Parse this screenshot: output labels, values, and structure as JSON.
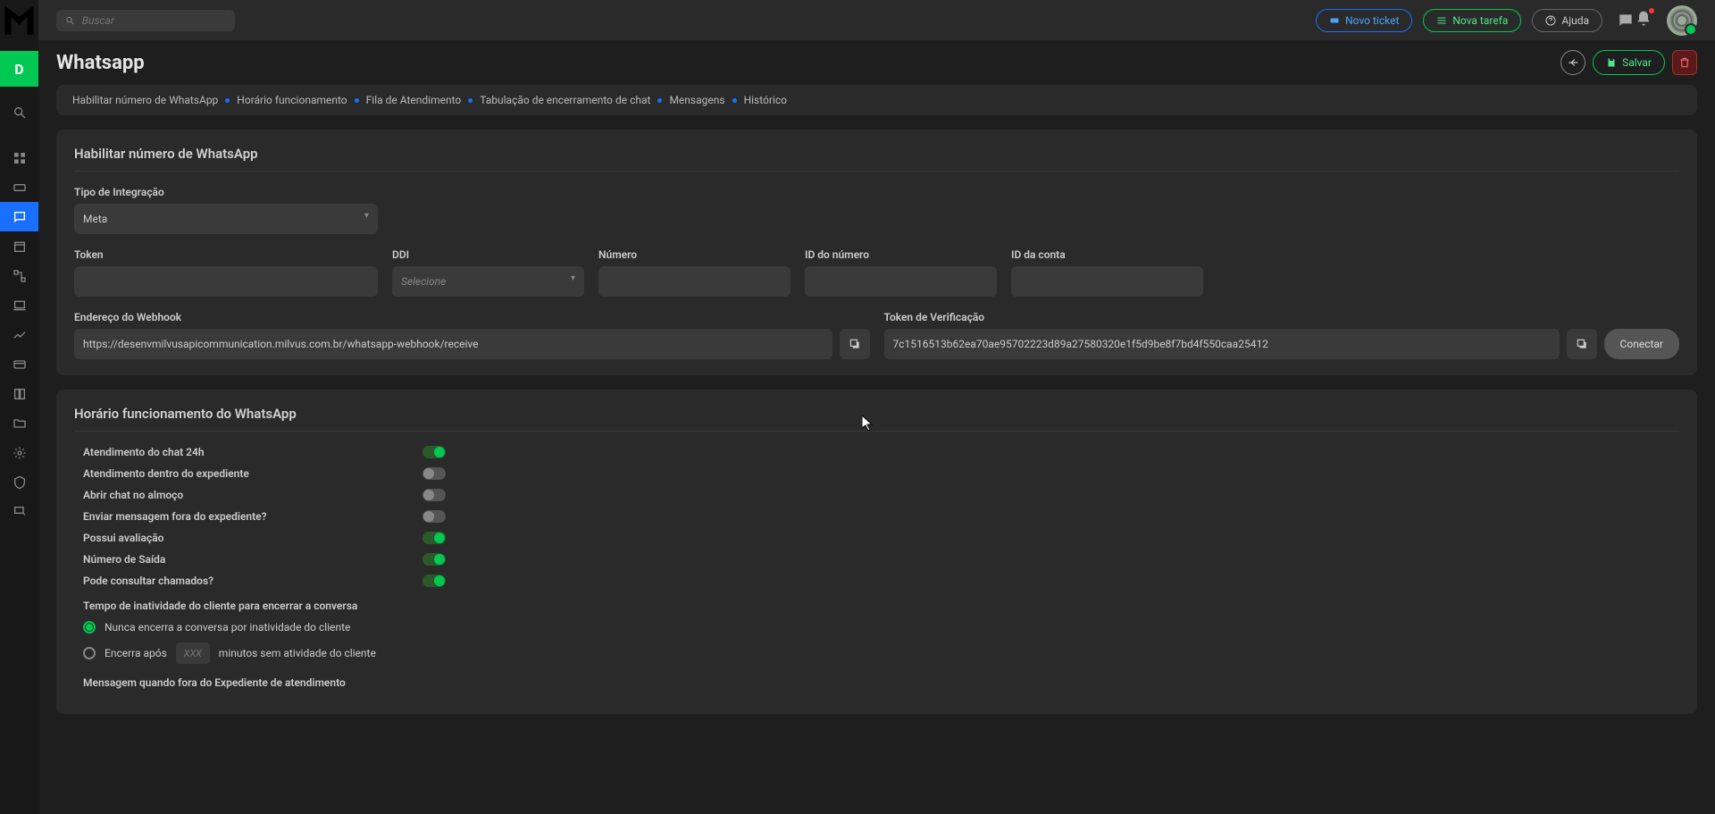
{
  "search": {
    "placeholder": "Buscar"
  },
  "topbar": {
    "new_ticket": "Novo ticket",
    "new_task": "Nova tarefa",
    "help": "Ajuda"
  },
  "sidebar": {
    "badge": "D"
  },
  "page": {
    "title": "Whatsapp",
    "save": "Salvar"
  },
  "tabs": {
    "t1": "Habilitar número de WhatsApp",
    "t2": "Horário funcionamento",
    "t3": "Fila de Atendimento",
    "t4": "Tabulação de encerramento de chat",
    "t5": "Mensagens",
    "t6": "Histórico"
  },
  "section1": {
    "title": "Habilitar número de WhatsApp",
    "tipo_label": "Tipo de Integração",
    "tipo_value": "Meta",
    "token_label": "Token",
    "ddi_label": "DDI",
    "ddi_placeholder": "Selecione",
    "numero_label": "Número",
    "id_numero_label": "ID do número",
    "id_conta_label": "ID da conta",
    "webhook_label": "Endereço do Webhook",
    "webhook_value": "https://desenvmilvusapicommunication.milvus.com.br/whatsapp-webhook/receive",
    "token_ver_label": "Token de Verificação",
    "token_ver_value": "7c1516513b62ea70ae95702223d89a27580320e1f5d9be8f7bd4f550caa25412",
    "conectar": "Conectar"
  },
  "section2": {
    "title": "Horário funcionamento do WhatsApp",
    "o1": "Atendimento do chat 24h",
    "o2": "Atendimento dentro do expediente",
    "o3": "Abrir chat no almoço",
    "o4": "Enviar mensagem fora do expediente?",
    "o5": "Possui avaliação",
    "o6": "Número de Saída",
    "o7": "Pode consultar chamados?",
    "timeout_heading": "Tempo de inatividade do cliente para encerrar a conversa",
    "r1": "Nunca encerra a conversa por inatividade do cliente",
    "r2a": "Encerra após",
    "r2b": "minutos sem atividade do cliente",
    "r2_placeholder": "XXX",
    "msg_heading": "Mensagem quando fora do Expediente de atendimento"
  }
}
